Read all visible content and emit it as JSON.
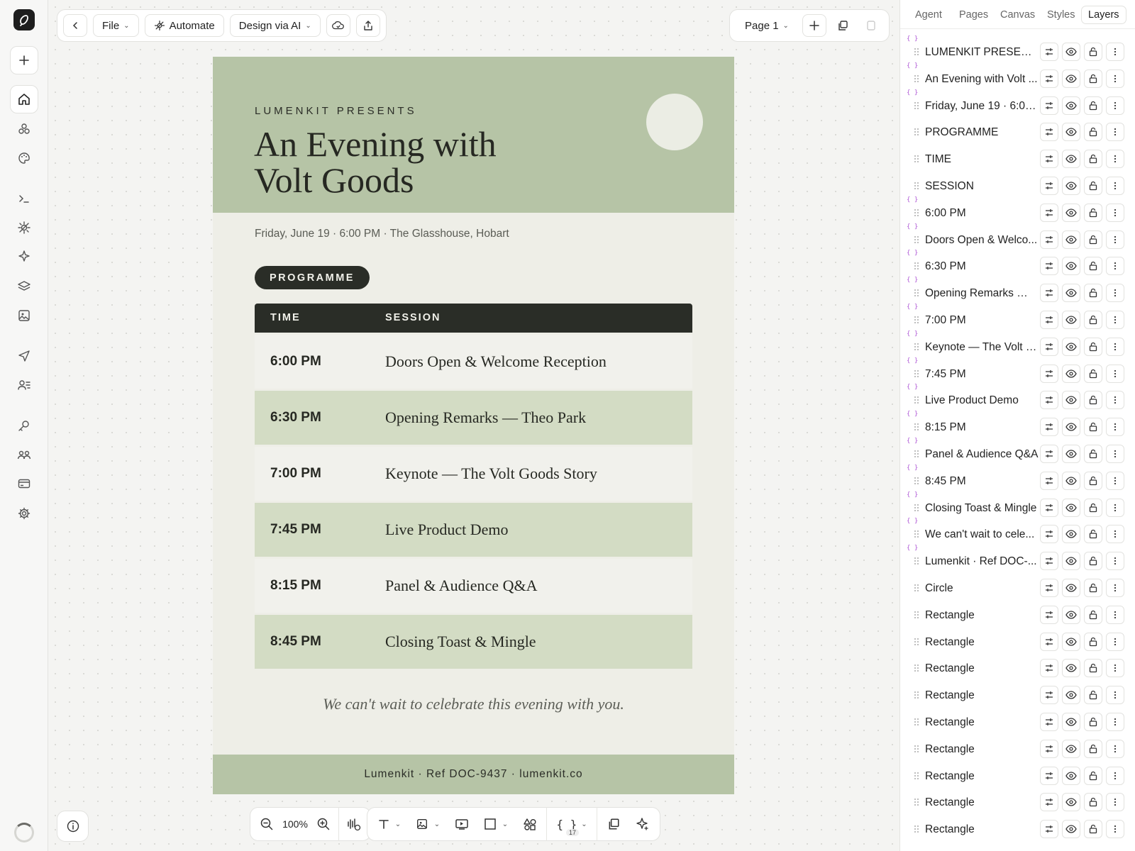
{
  "toolbar": {
    "back_label": "",
    "file_label": "File",
    "automate_label": "Automate",
    "design_ai_label": "Design via AI",
    "page_label": "Page 1"
  },
  "document": {
    "kicker": "LUMENKIT PRESENTS",
    "title": "An Evening with Volt Goods",
    "meta": "Friday, June 19 · 6:00 PM · The Glasshouse, Hobart",
    "programme_label": "PROGRAMME",
    "col_time": "TIME",
    "col_session": "SESSION",
    "rows": [
      {
        "time": "6:00 PM",
        "session": "Doors Open & Welcome Reception"
      },
      {
        "time": "6:30 PM",
        "session": "Opening Remarks — Theo Park"
      },
      {
        "time": "7:00 PM",
        "session": "Keynote — The Volt Goods Story"
      },
      {
        "time": "7:45 PM",
        "session": "Live Product Demo"
      },
      {
        "time": "8:15 PM",
        "session": "Panel & Audience Q&A"
      },
      {
        "time": "8:45 PM",
        "session": "Closing Toast & Mingle"
      }
    ],
    "closing": "We can't wait to celebrate this evening with you.",
    "footer": "Lumenkit · Ref DOC-9437 · lumenkit.co",
    "colors": {
      "accent": "#b6c4a6",
      "row_light": "#f1f1ec",
      "row_green": "#d3dcc4",
      "dark": "#2a2d27"
    }
  },
  "bottom_toolbar": {
    "zoom": "100%",
    "variables_badge": "17"
  },
  "panel": {
    "tabs": [
      "Agent",
      "Pages",
      "Canvas",
      "Styles",
      "Layers"
    ],
    "active_tab": "Layers",
    "layers": [
      {
        "name": "LUMENKIT PRESENTS",
        "var": true
      },
      {
        "name": "An Evening with Volt ...",
        "var": true
      },
      {
        "name": "Friday, June 19 · 6:00...",
        "var": true
      },
      {
        "name": "PROGRAMME",
        "var": false
      },
      {
        "name": "TIME",
        "var": false
      },
      {
        "name": "SESSION",
        "var": false
      },
      {
        "name": "6:00 PM",
        "var": true
      },
      {
        "name": "Doors Open & Welco...",
        "var": true
      },
      {
        "name": "6:30 PM",
        "var": true
      },
      {
        "name": "Opening Remarks — ...",
        "var": true
      },
      {
        "name": "7:00 PM",
        "var": true
      },
      {
        "name": "Keynote — The Volt G...",
        "var": true
      },
      {
        "name": "7:45 PM",
        "var": true
      },
      {
        "name": "Live Product Demo",
        "var": true
      },
      {
        "name": "8:15 PM",
        "var": true
      },
      {
        "name": "Panel & Audience Q&A",
        "var": true
      },
      {
        "name": "8:45 PM",
        "var": true
      },
      {
        "name": "Closing Toast & Mingle",
        "var": true
      },
      {
        "name": "We can't wait to cele...",
        "var": true
      },
      {
        "name": "Lumenkit · Ref DOC-...",
        "var": true
      },
      {
        "name": "Circle",
        "var": false
      },
      {
        "name": "Rectangle",
        "var": false
      },
      {
        "name": "Rectangle",
        "var": false
      },
      {
        "name": "Rectangle",
        "var": false
      },
      {
        "name": "Rectangle",
        "var": false
      },
      {
        "name": "Rectangle",
        "var": false
      },
      {
        "name": "Rectangle",
        "var": false
      },
      {
        "name": "Rectangle",
        "var": false
      },
      {
        "name": "Rectangle",
        "var": false
      },
      {
        "name": "Rectangle",
        "var": false
      }
    ]
  },
  "icons": {
    "rail": [
      "home-icon",
      "components-icon",
      "palette-icon",
      "terminal-icon",
      "automate-icon",
      "sparkle-icon",
      "layers-icon",
      "image-icon",
      "send-icon",
      "contacts-icon",
      "key-icon",
      "team-icon",
      "billing-icon",
      "settings-icon"
    ]
  }
}
